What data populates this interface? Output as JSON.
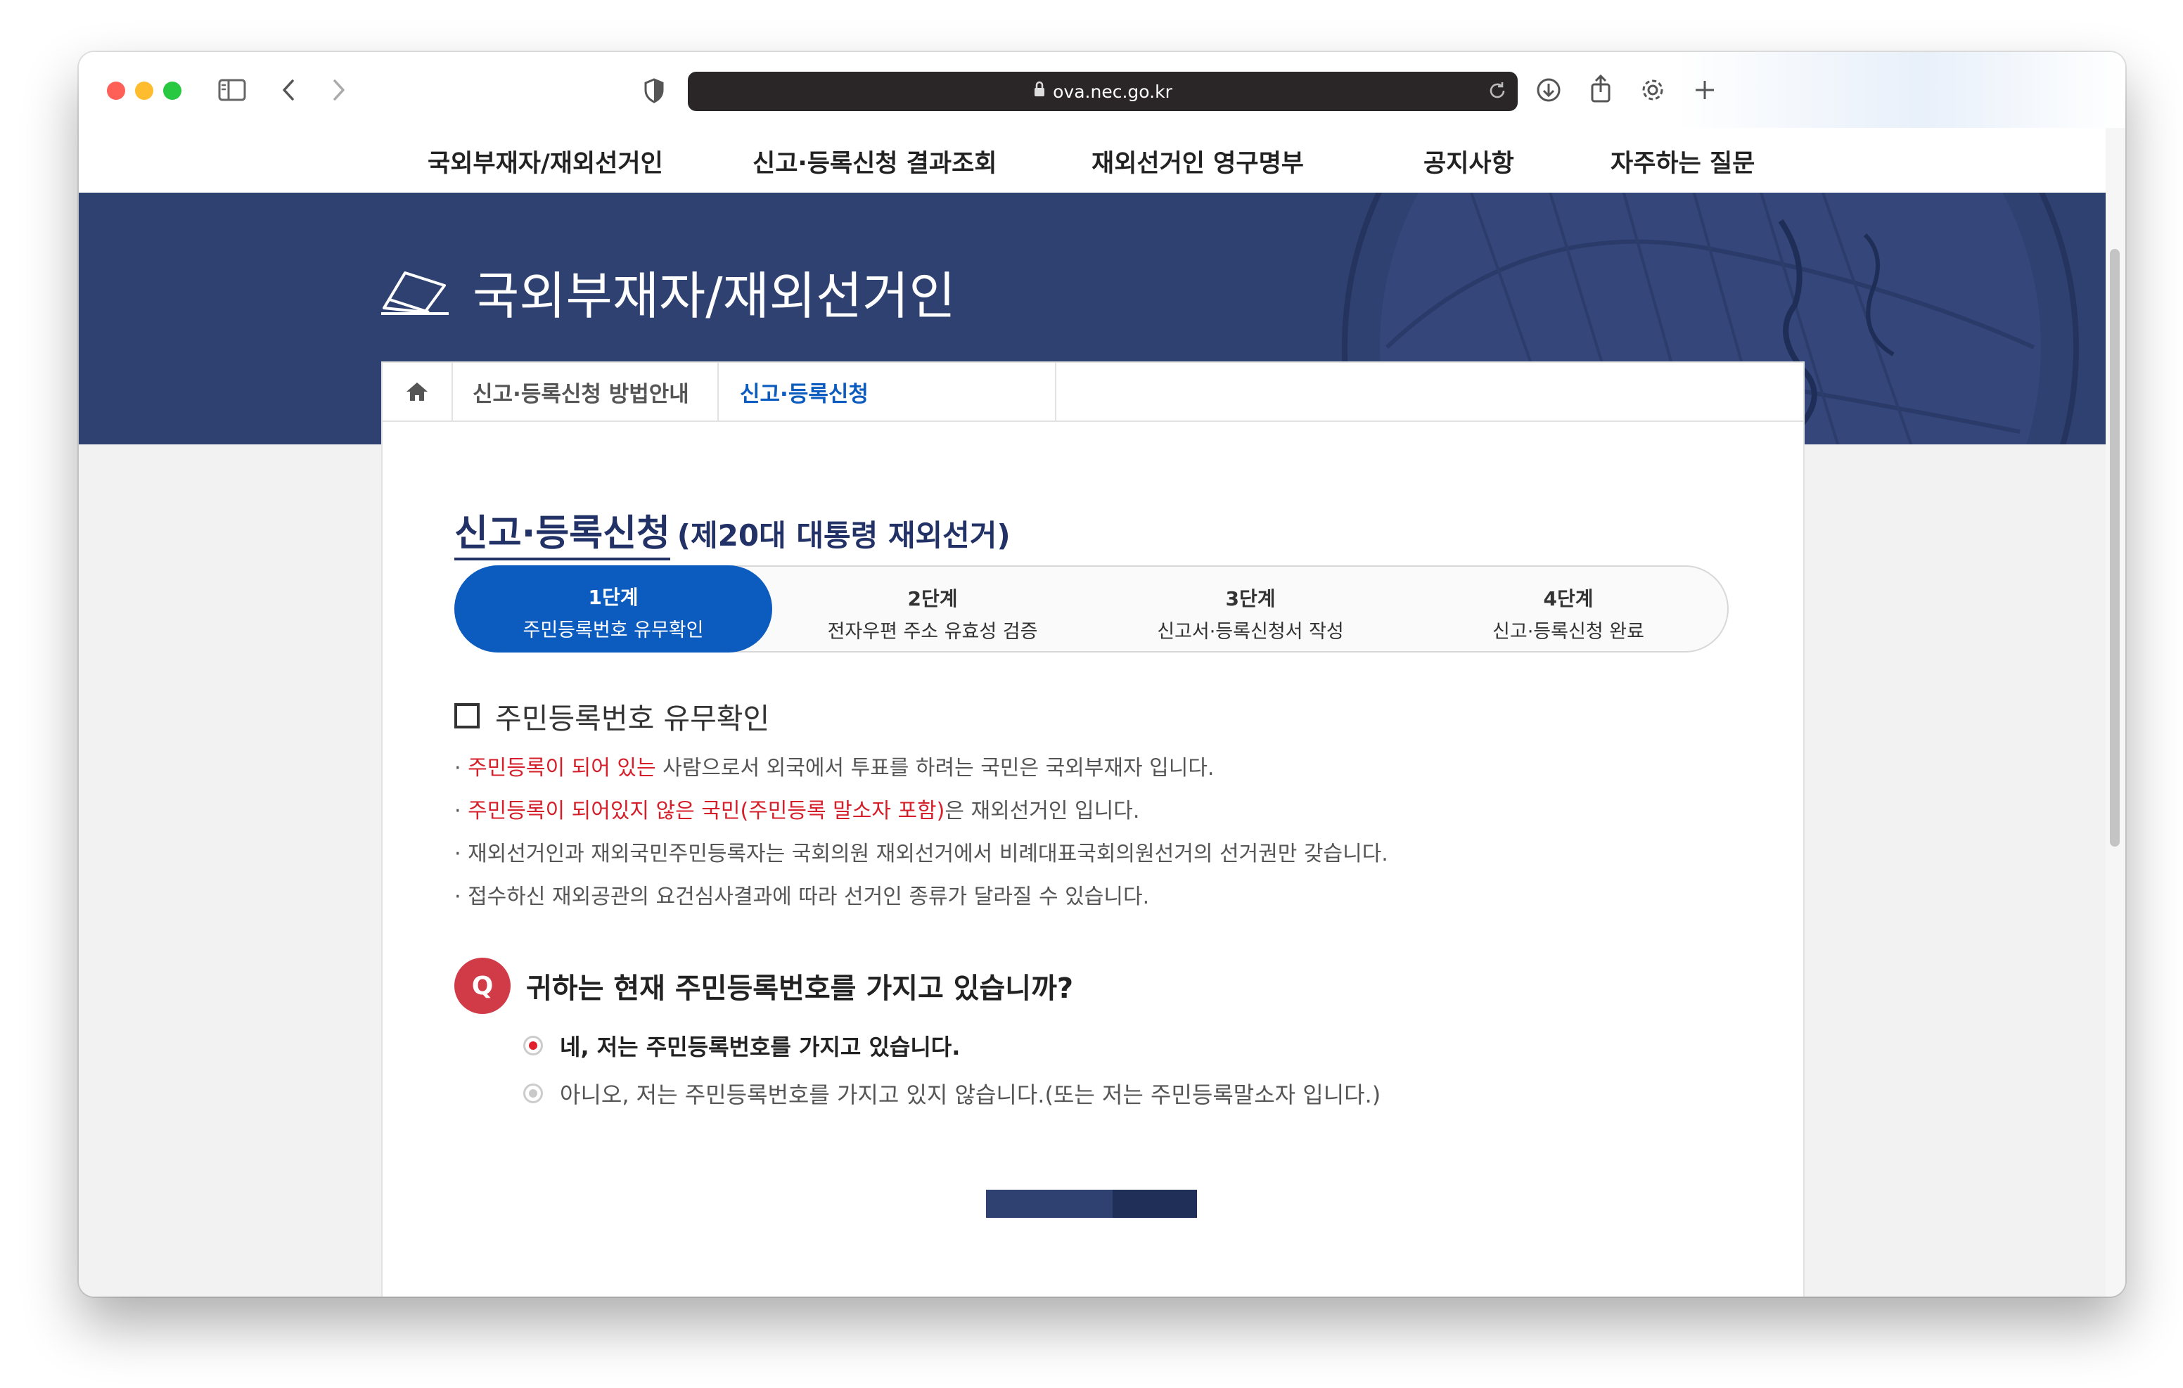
{
  "browser": {
    "url": "ova.nec.go.kr"
  },
  "topnav": {
    "items": [
      "국외부재자/재외선거인",
      "신고·등록신청 결과조회",
      "재외선거인 영구명부",
      "공지사항",
      "자주하는 질문"
    ]
  },
  "banner": {
    "title": "국외부재자/재외선거인"
  },
  "subnav": {
    "items": [
      "신고·등록신청 방법안내",
      "신고·등록신청"
    ]
  },
  "heading": {
    "main": "신고·등록신청",
    "sub": "(제20대 대통령 재외선거)"
  },
  "steps": [
    {
      "number": "1단계",
      "desc": "주민등록번호 유무확인"
    },
    {
      "number": "2단계",
      "desc": "전자우편 주소 유효성 검증"
    },
    {
      "number": "3단계",
      "desc": "신고서·등록신청서 작성"
    },
    {
      "number": "4단계",
      "desc": "신고·등록신청 완료"
    }
  ],
  "section": {
    "title": "주민등록번호 유무확인"
  },
  "bullets": [
    {
      "prefix": "· ",
      "highlight": "주민등록이 되어 있는",
      "rest": " 사람으로서 외국에서 투표를 하려는 국민은 국외부재자 입니다."
    },
    {
      "prefix": "· ",
      "highlight": "주민등록이 되어있지 않은 국민(주민등록 말소자 포함)",
      "rest": "은 재외선거인 입니다."
    },
    {
      "prefix": "· ",
      "highlight": "",
      "rest": "재외선거인과 재외국민주민등록자는 국회의원 재외선거에서 비례대표국회의원선거의 선거권만 갖습니다."
    },
    {
      "prefix": "· ",
      "highlight": "",
      "rest": "접수하신 재외공관의 요건심사결과에 따라 선거인 종류가 달라질 수 있습니다."
    }
  ],
  "question": {
    "badge": "Q",
    "text": "귀하는 현재 주민등록번호를 가지고 있습니까?"
  },
  "options": [
    {
      "label": "네, 저는 주민등록번호를 가지고 있습니다.",
      "selected": true
    },
    {
      "label": "아니오, 저는 주민등록번호를 가지고 있지 않습니다.(또는 저는 주민등록말소자 입니다.)",
      "selected": false
    }
  ],
  "colors": {
    "accent": "#0c5bbf",
    "banner": "#2f4171",
    "highlight": "#d5202b",
    "question_badge": "#d13b47"
  }
}
